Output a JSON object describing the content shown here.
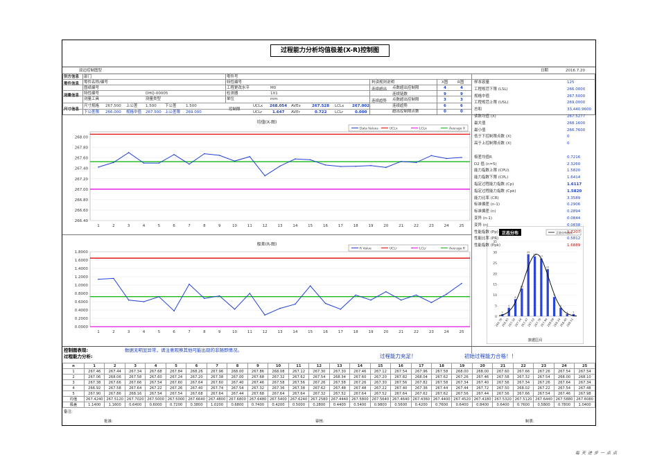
{
  "title": "过程能力分析均值极差(X-R)控制图",
  "doc_label": "双边控制图型",
  "date_label": "日期",
  "date": "2016.7.20",
  "sections": {
    "supplier": "供方信息",
    "part": "零件信息",
    "measure": "测量信息",
    "size": "尺寸信息",
    "dept": "部门",
    "part_no_lbl": "零件号",
    "part_name_lbl": "零件名称/编号",
    "drawing_lbl": "图纸编号",
    "drawing": "DHQ-00005",
    "change_lbl": "工程更改水平",
    "change": "M0",
    "char_lbl": "特性编号",
    "gauge_lbl": "检测器",
    "gauge": "1X1",
    "meas_lbl": "测量工具",
    "meas_type_lbl": "测量类型",
    "unit_lbl": "单位",
    "unit": "mm",
    "spec_lbl": "尺寸规格",
    "spec": "267.500",
    "up_tol_lbl": "上公差",
    "up_tol": "1.500",
    "low_tol_lbl": "下公差",
    "low_tol": "1.500",
    "usl_lbl": "上公差限",
    "usl_v": "269.000",
    "center_lbl": "规格中值",
    "center_v": "267.500",
    "lsl_lbl": "下公差限",
    "lsl_v": "266.000",
    "ctrl_lbl": "控制限"
  },
  "limits": {
    "uclx_lbl": "UCLx",
    "uclx": "268.054",
    "avex_lbl": "AVEx",
    "avex": "267.528",
    "lclx_lbl": "LCLx",
    "lclx": "267.002",
    "uclr_lbl": "UCLr",
    "uclr": "1.647",
    "aver_lbl": "AVEr",
    "aver": "0.722",
    "lclr_lbl": "LCLr",
    "lclr": "0.000"
  },
  "judge": {
    "header": "判读规则说明",
    "xcol": "X图",
    "rcol": "R图",
    "rows": [
      {
        "label": "连续超出",
        "sub": "点数超出控制限",
        "x": "4",
        "r": "4"
      },
      {
        "label": "",
        "sub": "连续链数",
        "x": "9",
        "r": "9"
      },
      {
        "label": "连续趋势",
        "sub": "点数超出控制限",
        "x": "3",
        "r": "3"
      },
      {
        "label": "",
        "sub": "连续趋势",
        "x": "6",
        "r": "6"
      },
      {
        "label": "",
        "sub": "超出控制限点数",
        "x": "0",
        "r": "0"
      }
    ]
  },
  "stats": [
    {
      "k": "样本容量",
      "v": "125"
    },
    {
      "k": "工程规范下限 (LSL)",
      "v": "266.0000"
    },
    {
      "k": "规格中值",
      "v": "267.5000"
    },
    {
      "k": "工程规范上限 (USL)",
      "v": "269.0000"
    },
    {
      "k": "总和",
      "v": "33,440.9600"
    },
    {
      "k": "读数均值 (X)",
      "v": "267.5277"
    },
    {
      "k": "最大值",
      "v": "268.1600"
    },
    {
      "k": "最小值",
      "v": "266.7600"
    },
    {
      "k": "低于下控制限点数 (X)",
      "v": "0"
    },
    {
      "k": "高于上控制限点数 (X)",
      "v": "0"
    },
    {
      "k": "",
      "v": ""
    },
    {
      "k": "极差均值R",
      "v": "0.7216"
    },
    {
      "k": "D2 值 (n=5)",
      "v": "2.3260"
    },
    {
      "k": "能力指数上限 (CPU)",
      "v": "1.5820"
    },
    {
      "k": "能力指数下限 (CPL)",
      "v": "1.6414"
    },
    {
      "k": "指定过程能力指数 (Cp)",
      "v": "1.6117"
    },
    {
      "k": "指定过程能力指数 (Cpk)",
      "v": "1.5820"
    },
    {
      "k": "能力比率 (CR)",
      "v": "3.3589"
    },
    {
      "k": "标准偏差 (n-1)",
      "v": "0.2906"
    },
    {
      "k": "标准偏差 (n)",
      "v": "0.2894"
    },
    {
      "k": "变异 (n-1)",
      "v": "0.0844"
    },
    {
      "k": "变异 (n)",
      "v": "0.0838"
    },
    {
      "k": "性能指数 (Pp)",
      "v": "1.7207"
    },
    {
      "k": "性能比率 (PR)",
      "v": "0.5812"
    },
    {
      "k": "性能指数 (Ppk)",
      "v": "1.6889"
    }
  ],
  "analysis": {
    "ctrl_label": "控制图表现:",
    "ctrl_text": "数据无明显异常，请注意观察其他可能出现的非随即情况。",
    "cap_label": "过程能力分析:",
    "cap_text1": "过程能力充足！",
    "cap_text2": "初始过程能力合格！！"
  },
  "table": {
    "n_label": "n",
    "cols": [
      "1",
      "2",
      "3",
      "4",
      "5",
      "6",
      "7",
      "8",
      "9",
      "10",
      "11",
      "12",
      "13",
      "14",
      "15",
      "16",
      "17",
      "18",
      "19",
      "20",
      "21",
      "22",
      "23",
      "24",
      "25"
    ],
    "rows": [
      {
        "n": "1",
        "vals": [
          "267.46",
          "267.44",
          "267.34",
          "267.68",
          "267.84",
          "268.26",
          "267.96",
          "268.00",
          "267.86",
          "268.08",
          "267.12",
          "267.30",
          "267.30",
          "267.46",
          "267.12",
          "267.54",
          "267.96",
          "267.58",
          "268.00",
          "268.00",
          "267.60",
          "267.66",
          "267.26",
          "267.54",
          "267.54"
        ]
      },
      {
        "n": "2",
        "vals": [
          "267.06",
          "268.06",
          "267.58",
          "267.60",
          "267.24",
          "267.20",
          "267.38",
          "267.00",
          "267.68",
          "267.32",
          "267.62",
          "267.54",
          "268.34",
          "267.60",
          "267.20",
          "267.82",
          "268.04",
          "267.62",
          "267.26",
          "267.46",
          "267.58",
          "267.32",
          "267.54",
          "268.00",
          "268.10"
        ]
      },
      {
        "n": "3",
        "vals": [
          "267.38",
          "267.66",
          "267.66",
          "267.54",
          "267.60",
          "267.64",
          "267.60",
          "267.40",
          "267.46",
          "267.58",
          "267.56",
          "267.26",
          "267.58",
          "267.26",
          "267.30",
          "267.56",
          "267.82",
          "267.58",
          "267.34",
          "267.40",
          "267.56",
          "267.34",
          "267.26",
          "267.64",
          "267.34"
        ]
      },
      {
        "n": "4",
        "vals": [
          "266.92",
          "267.58",
          "267.64",
          "267.22",
          "267.26",
          "267.40",
          "267.74",
          "267.54",
          "267.32",
          "267.36",
          "267.38",
          "267.62",
          "267.48",
          "267.48",
          "267.22",
          "267.40",
          "267.36",
          "267.44",
          "267.44",
          "267.72",
          "267.50",
          "268.02",
          "267.22",
          "267.54",
          "267.48"
        ]
      },
      {
        "n": "5",
        "vals": [
          "267.90",
          "267.86",
          "268.16",
          "267.54",
          "267.54",
          "267.68",
          "267.64",
          "267.44",
          "267.68",
          "267.64",
          "267.64",
          "267.32",
          "267.52",
          "267.64",
          "267.52",
          "267.64",
          "267.62",
          "267.62",
          "267.56",
          "267.44",
          "267.56",
          "267.66",
          "267.54",
          "267.46",
          "267.98"
        ]
      }
    ],
    "avg_label": "均值",
    "avg": [
      "267.4240",
      "267.5120",
      "267.7020",
      "267.5000",
      "267.5000",
      "267.6640",
      "267.4800",
      "267.6800",
      "267.6480",
      "267.5400",
      "267.6240",
      "267.2580",
      "267.4440",
      "267.5800",
      "267.5640",
      "267.4640",
      "267.4360",
      "267.4400",
      "267.4520",
      "267.4180",
      "267.5320",
      "267.5120",
      "267.6440",
      "267.5880",
      "267.6080"
    ],
    "range_label": "极差",
    "range": [
      "1.1400",
      "1.1600",
      "0.6400",
      "0.6000",
      "0.7200",
      "0.3800",
      "1.0200",
      "0.6800",
      "0.7400",
      "0.4200",
      "0.5000",
      "0.2800",
      "0.4400",
      "0.5400",
      "0.9800",
      "0.5600",
      "0.4200",
      "0.7600",
      "0.6400",
      "0.8400",
      "0.6400",
      "0.7600",
      "0.5800",
      "0.7800",
      "1.0400"
    ]
  },
  "signature": {
    "notes": "备注:",
    "approve": "批准:",
    "check": "审核:",
    "make": "制表:"
  },
  "footer": "每天进步一点点",
  "x_chart": {
    "title": "均值(X-图)",
    "legend": [
      "Data Values",
      "UCLx",
      "LCLx",
      "Average X"
    ],
    "ylim": [
      266.4,
      268.1
    ],
    "yticks": [
      "268.00",
      "267.80",
      "267.60",
      "267.40",
      "267.20",
      "267.00",
      "266.80",
      "266.60",
      "266.40"
    ]
  },
  "r_chart": {
    "title": "极差(R-图)",
    "legend": [
      "R Value",
      "UCLr",
      "LCLr",
      "Average R"
    ],
    "ylim": [
      0,
      1.8
    ],
    "yticks": [
      "1.8000",
      "1.6000",
      "1.4000",
      "1.2000",
      "1.0000",
      "0.8000",
      "0.6000",
      "0.4000",
      "0.2000",
      "0.0000"
    ]
  },
  "hist": {
    "title": "正态分布",
    "legend": "正态分布曲线",
    "xlabel": "数据区间",
    "yticks": [
      "35",
      "30",
      "25",
      "20",
      "15",
      "10",
      "5",
      "0"
    ],
    "bins": [
      "266.78",
      "266.93",
      "267.10",
      "267.24",
      "267.47",
      "267.62",
      "267.78",
      "267.94",
      "268.09",
      "268.24",
      "268.40",
      "268.51"
    ],
    "counts": [
      1,
      4,
      8,
      13,
      29,
      28,
      27,
      22,
      9,
      4,
      1,
      1
    ]
  },
  "chart_data": [
    {
      "type": "line",
      "title": "均值(X-图)",
      "x": [
        1,
        2,
        3,
        4,
        5,
        6,
        7,
        8,
        9,
        10,
        11,
        12,
        13,
        14,
        15,
        16,
        17,
        18,
        19,
        20,
        21,
        22,
        23,
        24,
        25
      ],
      "series": [
        {
          "name": "Data Values",
          "values": [
            267.424,
            267.512,
            267.702,
            267.5,
            267.5,
            267.664,
            267.48,
            267.68,
            267.648,
            267.54,
            267.624,
            267.258,
            267.444,
            267.58,
            267.564,
            267.464,
            267.436,
            267.44,
            267.452,
            267.418,
            267.532,
            267.512,
            267.644,
            267.588,
            267.608
          ]
        },
        {
          "name": "UCLx",
          "values": [
            268.054
          ]
        },
        {
          "name": "LCLx",
          "values": [
            267.002
          ]
        },
        {
          "name": "Average X",
          "values": [
            267.528
          ]
        }
      ],
      "ylim": [
        266.4,
        268.1
      ]
    },
    {
      "type": "line",
      "title": "极差(R-图)",
      "x": [
        1,
        2,
        3,
        4,
        5,
        6,
        7,
        8,
        9,
        10,
        11,
        12,
        13,
        14,
        15,
        16,
        17,
        18,
        19,
        20,
        21,
        22,
        23,
        24,
        25
      ],
      "series": [
        {
          "name": "R Value",
          "values": [
            1.14,
            1.16,
            0.64,
            0.6,
            0.72,
            0.38,
            1.02,
            0.68,
            0.74,
            0.42,
            0.8,
            0.28,
            0.44,
            0.54,
            0.98,
            0.56,
            0.42,
            0.76,
            0.64,
            0.84,
            0.64,
            0.76,
            0.58,
            0.78,
            1.04
          ]
        },
        {
          "name": "UCLr",
          "values": [
            1.647
          ]
        },
        {
          "name": "LCLr",
          "values": [
            0.0
          ]
        },
        {
          "name": "Average R",
          "values": [
            0.722
          ]
        }
      ],
      "ylim": [
        0,
        1.8
      ]
    },
    {
      "type": "bar",
      "title": "正态分布",
      "categories": [
        "266.78",
        "266.93",
        "267.10",
        "267.24",
        "267.47",
        "267.62",
        "267.78",
        "267.94",
        "268.09",
        "268.24",
        "268.40",
        "268.51"
      ],
      "values": [
        1,
        4,
        8,
        13,
        29,
        28,
        27,
        22,
        9,
        4,
        1,
        1
      ],
      "xlabel": "数据区间",
      "ylim": [
        0,
        35
      ]
    }
  ]
}
